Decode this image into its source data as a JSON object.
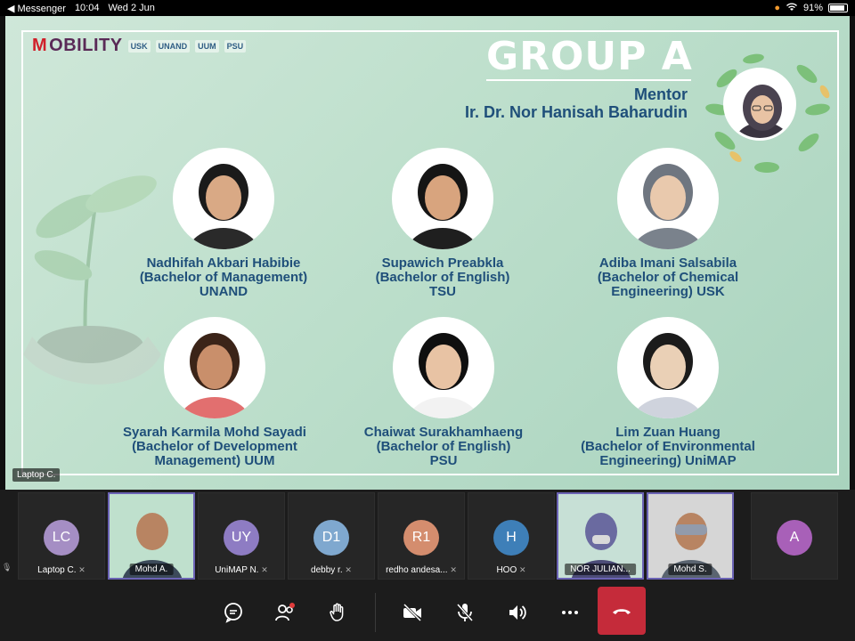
{
  "status_bar": {
    "back_app": "◀ Messenger",
    "time": "10:04",
    "date": "Wed 2 Jun",
    "battery_level": 91,
    "battery_percent": "91%"
  },
  "slide": {
    "logos": {
      "brand_prefix": "M",
      "brand_rest": "OBILITY",
      "usk": "USK",
      "unand": "UNAND",
      "uum": "UUM",
      "psu": "PSU"
    },
    "title": "GROUP A",
    "mentor_label": "Mentor",
    "mentor_name": "Ir. Dr. Nor Hanisah Baharudin",
    "members": [
      {
        "name": "Nadhifah Akbari Habibie",
        "line2": "(Bachelor of Management)",
        "line3": "UNAND"
      },
      {
        "name": "Supawich Preabkla",
        "line2": "(Bachelor of English)",
        "line3": "TSU"
      },
      {
        "name": "Adiba Imani Salsabila",
        "line2": "(Bachelor of Chemical",
        "line3": "Engineering) USK"
      },
      {
        "name": "Syarah Karmila Mohd Sayadi",
        "line2": "(Bachelor of Development",
        "line3": "Management) UUM"
      },
      {
        "name": "Chaiwat Surakhamhaeng",
        "line2": "(Bachelor of English)",
        "line3": "PSU"
      },
      {
        "name": "Lim Zuan Huang",
        "line2": "(Bachelor of Environmental",
        "line3": "Engineering) UniMAP"
      }
    ],
    "presenter_tag": "Laptop C."
  },
  "gallery": {
    "participants": [
      {
        "initials": "LC",
        "name": "Laptop C.",
        "color": "#a58ec4",
        "type": "avatar"
      },
      {
        "initials": "",
        "name": "Mohd A.",
        "type": "video"
      },
      {
        "initials": "UY",
        "name": "UniMAP N.",
        "color": "#8e7cc3",
        "type": "avatar"
      },
      {
        "initials": "D1",
        "name": "debby r.",
        "color": "#7fa8cf",
        "type": "avatar"
      },
      {
        "initials": "R1",
        "name": "redho andesa...",
        "color": "#d48d6e",
        "type": "avatar"
      },
      {
        "initials": "H",
        "name": "HOO",
        "color": "#3e7fb8",
        "type": "avatar"
      },
      {
        "initials": "",
        "name": "NOR JULIAN...",
        "type": "video"
      },
      {
        "initials": "",
        "name": "Mohd S.",
        "type": "video"
      },
      {
        "initials": "A",
        "name": "",
        "color": "#a860b8",
        "type": "avatar"
      }
    ],
    "mute_glyph": "🎙̸"
  },
  "toolbar": {
    "icons": [
      "chat-icon",
      "participants-icon",
      "raise-hand-icon",
      "camera-off-icon",
      "mic-off-icon",
      "speaker-icon",
      "more-icon",
      "end-call-icon"
    ]
  }
}
